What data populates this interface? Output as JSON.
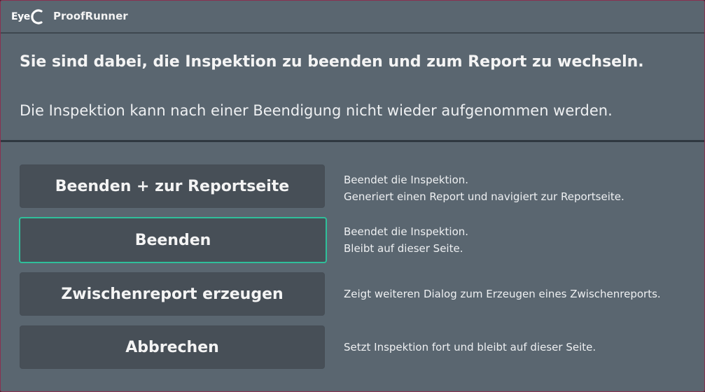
{
  "app": {
    "logo_text": "Eye",
    "title": "ProofRunner"
  },
  "dialog": {
    "heading": "Sie sind dabei, die Inspektion zu beenden und zum Report zu wechseln.",
    "subheading": "Die Inspektion kann nach einer Beendigung nicht wieder aufgenommen werden."
  },
  "options": [
    {
      "label": "Beenden + zur Reportseite",
      "desc_line1": "Beendet die Inspektion.",
      "desc_line2": "Generiert einen Report und navigiert zur Reportseite."
    },
    {
      "label": "Beenden",
      "desc_line1": "Beendet die Inspektion.",
      "desc_line2": "Bleibt auf dieser Seite."
    },
    {
      "label": "Zwischenreport erzeugen",
      "desc_line1": "Zeigt weiteren Dialog zum Erzeugen eines Zwischenreports."
    },
    {
      "label": "Abbrechen",
      "desc_line1": "Setzt Inspektion fort und bleibt auf dieser Seite."
    }
  ],
  "colors": {
    "dialog_bg": "#5a6670",
    "button_bg": "#474f57",
    "focus_border": "#2fbf9a",
    "outer_border": "#8a3050"
  }
}
